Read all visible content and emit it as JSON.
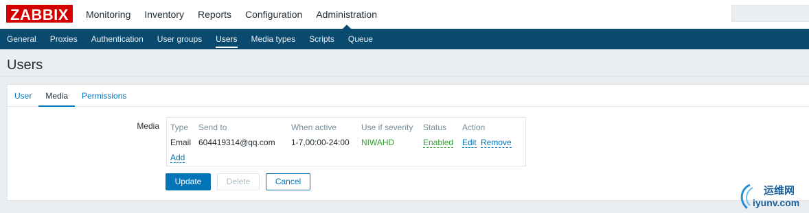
{
  "logo": "ZABBIX",
  "main_nav": [
    "Monitoring",
    "Inventory",
    "Reports",
    "Configuration",
    "Administration"
  ],
  "main_nav_active": "Administration",
  "sub_nav": [
    "General",
    "Proxies",
    "Authentication",
    "User groups",
    "Users",
    "Media types",
    "Scripts",
    "Queue"
  ],
  "sub_nav_active": "Users",
  "page_title": "Users",
  "tabs": [
    "User",
    "Media",
    "Permissions"
  ],
  "active_tab": "Media",
  "media": {
    "label": "Media",
    "headers": {
      "type": "Type",
      "send_to": "Send to",
      "when_active": "When active",
      "severity": "Use if severity",
      "status": "Status",
      "action": "Action"
    },
    "rows": [
      {
        "type": "Email",
        "send_to": "604419314@qq.com",
        "when_active": "1-7,00:00-24:00",
        "severity": "NIWAHD",
        "status": "Enabled",
        "edit": "Edit",
        "remove": "Remove"
      }
    ],
    "add_label": "Add"
  },
  "buttons": {
    "update": "Update",
    "delete": "Delete",
    "cancel": "Cancel"
  },
  "watermark": {
    "chinese": "运维网",
    "domain": "iyunv.com"
  },
  "colors": {
    "brand_red": "#d40000",
    "subnav_bg": "#0b4a6f",
    "link_blue": "#0275b8",
    "status_green": "#2f9f2f"
  }
}
